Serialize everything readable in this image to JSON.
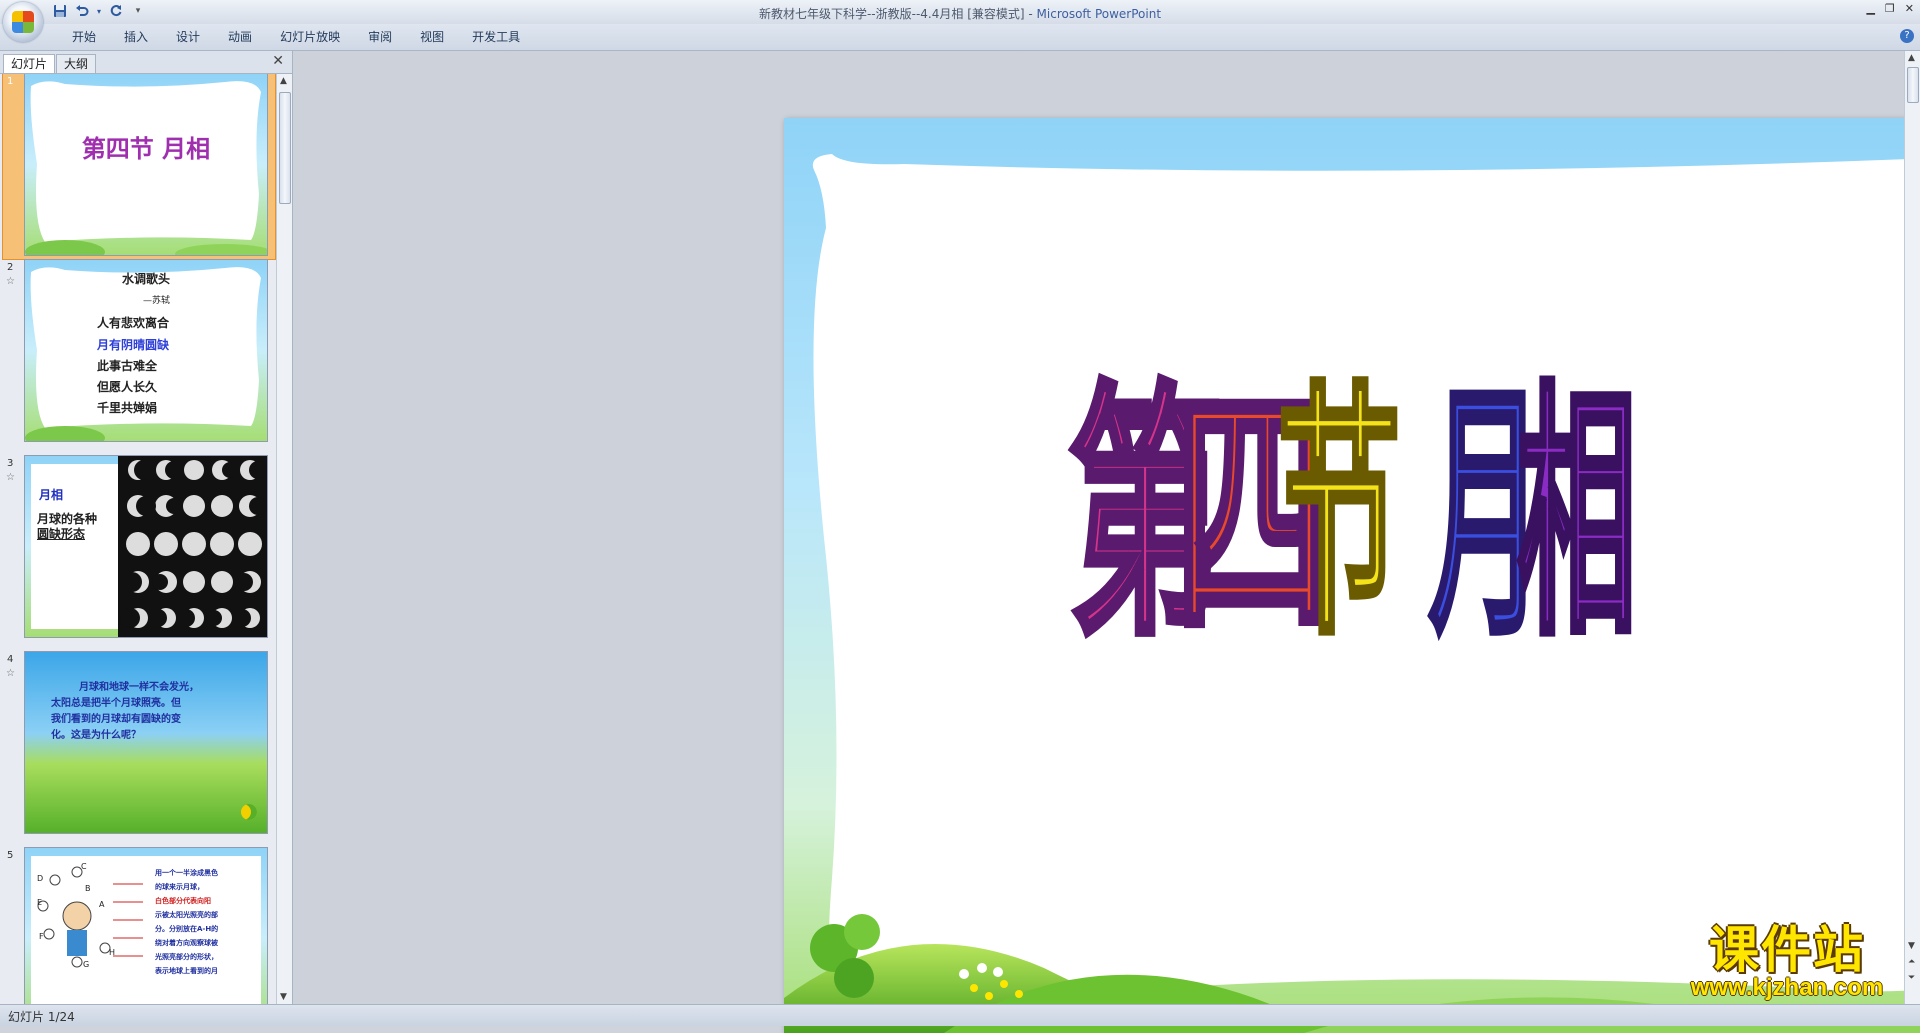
{
  "window": {
    "title_document": "新教材七年级下科学--浙教版--4.4月相 [兼容模式]",
    "title_separator": " - ",
    "title_app": "Microsoft PowerPoint"
  },
  "quick_access": {
    "icons": [
      "save-icon",
      "undo-icon",
      "redo-icon",
      "customize-icon"
    ]
  },
  "ribbon": {
    "tabs": [
      "开始",
      "插入",
      "设计",
      "动画",
      "幻灯片放映",
      "审阅",
      "视图",
      "开发工具"
    ]
  },
  "left_pane": {
    "tab_slides": "幻灯片",
    "tab_outline": "大纲",
    "close_label": "✕"
  },
  "thumbnails": [
    {
      "number": "1",
      "title": "第四节  月相"
    },
    {
      "number": "2",
      "title": "水调歌头",
      "author": "—苏轼",
      "lines": [
        "人有悲欢离合",
        "月有阴晴圆缺",
        "此事古难全",
        "但愿人长久",
        "千里共婵娟"
      ]
    },
    {
      "number": "3",
      "label1": "月相",
      "label2": "月球的各种",
      "label3": "圆缺形态"
    },
    {
      "number": "4",
      "text": [
        "月球和地球一样不会发光，",
        "太阳总是把半个月球照亮。但",
        "我们看到的月球却有圆缺的变",
        "化。这是为什么呢？"
      ]
    },
    {
      "number": "5",
      "labels": [
        "D",
        "C",
        "B",
        "A",
        "E",
        "F",
        "G",
        "H"
      ],
      "text": [
        "用一个一半涂成黑色",
        "的球来示月球，",
        "白色部分代表向阳",
        "示被太阳光照亮的部",
        "分。分别放在A-H的",
        "绕对着方向观察球被",
        "光照亮部分的形状，",
        "表示地球上看到的月"
      ]
    }
  ],
  "main_slide": {
    "title_chars": [
      "第",
      "四",
      "节",
      "月",
      "相"
    ]
  },
  "status_bar": {
    "text": "幻灯片 1/24"
  },
  "watermark": {
    "text_cn": "课件站",
    "url": "www.kjzhan.com"
  },
  "colors": {
    "title_char_1": "#d6338a",
    "title_char_2": "#e8492a",
    "title_char_3": "#f5e31a",
    "title_char_4": "#3a4fe0",
    "title_char_5": "#8a2cc4",
    "frame_sky": "#8fd3f7",
    "frame_grass": "#7cc84a",
    "selection": "#f6c177"
  }
}
